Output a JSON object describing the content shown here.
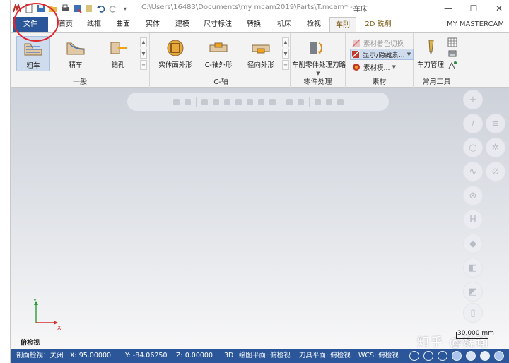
{
  "window": {
    "path": "C:\\Users\\16483\\Documents\\my mcam2019\\Parts\\T.mcam* -...",
    "context_title": "车床",
    "minimize": "—",
    "maximize": "☐",
    "close": "✕"
  },
  "tabs": [
    {
      "label": "文件"
    },
    {
      "label": "首页"
    },
    {
      "label": "线框"
    },
    {
      "label": "曲面"
    },
    {
      "label": "实体"
    },
    {
      "label": "建模"
    },
    {
      "label": "尺寸标注"
    },
    {
      "label": "转换"
    },
    {
      "label": "机床"
    },
    {
      "label": "检视"
    },
    {
      "label": "车削"
    },
    {
      "label": "2D 铣削"
    }
  ],
  "account": "MY MASTERCAM",
  "ribbon": {
    "general": {
      "title": "一般",
      "rough": "粗车",
      "finish": "精车",
      "drill": "钻孔"
    },
    "c_axis": {
      "title": "C-轴",
      "face_contour": "实体面外形",
      "c_contour": "C-轴外形",
      "radial_contour": "径向外形"
    },
    "part_handling": {
      "title": "零件处理",
      "toolpath": "车削零件处理刀路"
    },
    "stock": {
      "title": "素材",
      "color_cut": "素材着色切换",
      "show_hide": "显示/隐藏素...",
      "stock_model": "素材模..."
    },
    "tools": {
      "title": "常用工具",
      "tool_manager": "车刀管理"
    }
  },
  "viewport": {
    "view_name": "俯检视",
    "axis_x": "X",
    "axis_y": "Y",
    "scale": "30.000 mm",
    "watermark": "知乎 @魏瑜"
  },
  "statusbar": {
    "section_view": "剖面检视：关闭",
    "x": "X:  95.00000",
    "y": "Y:  -84.06250",
    "z": "Z:  0.00000",
    "mode": "3D",
    "cplane": "绘图平面: 俯检视",
    "tplane": "刀具平面: 俯检视",
    "wcs": "WCS: 俯检视"
  },
  "colors": {
    "file_tab": "#2b579a",
    "status_bar": "#2b579a",
    "annotation": "#e0252f"
  }
}
